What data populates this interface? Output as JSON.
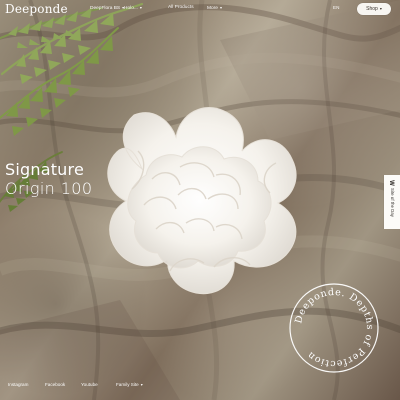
{
  "brand": {
    "name": "Deeponde"
  },
  "topbar": {
    "nav": [
      {
        "label": "DeepFlora BS",
        "has_dropdown": true
      },
      {
        "label": "Holo...",
        "has_dropdown": true
      },
      {
        "label": "All Products",
        "has_dropdown": false
      },
      {
        "label": "More",
        "has_dropdown": true
      }
    ],
    "language": "EN",
    "shop_button": {
      "label": "Shop",
      "has_dropdown": true
    }
  },
  "hero": {
    "title_line_1": "Signature",
    "title_line_2": "Origin 100"
  },
  "side_tab": {
    "icon_label": "W",
    "label": "Site of the Day"
  },
  "bottom_links": [
    {
      "label": "Instagram",
      "has_dropdown": false
    },
    {
      "label": "Facebook",
      "has_dropdown": false
    },
    {
      "label": "Youtube",
      "has_dropdown": false
    },
    {
      "label": "Family Site",
      "has_dropdown": true
    }
  ],
  "seal": {
    "text": "Deeponde. Depths of Perfection"
  },
  "colors": {
    "text_light": "#ffffff",
    "button_bg": "#f7f5f1",
    "button_text": "#3a332d",
    "side_tab_bg": "#fcfbf8",
    "side_tab_text": "#2d2824",
    "flower_white": "#f8f7f2"
  },
  "icons": {
    "dropdown": "chevron-down-icon",
    "seal": "circular-seal-icon"
  }
}
